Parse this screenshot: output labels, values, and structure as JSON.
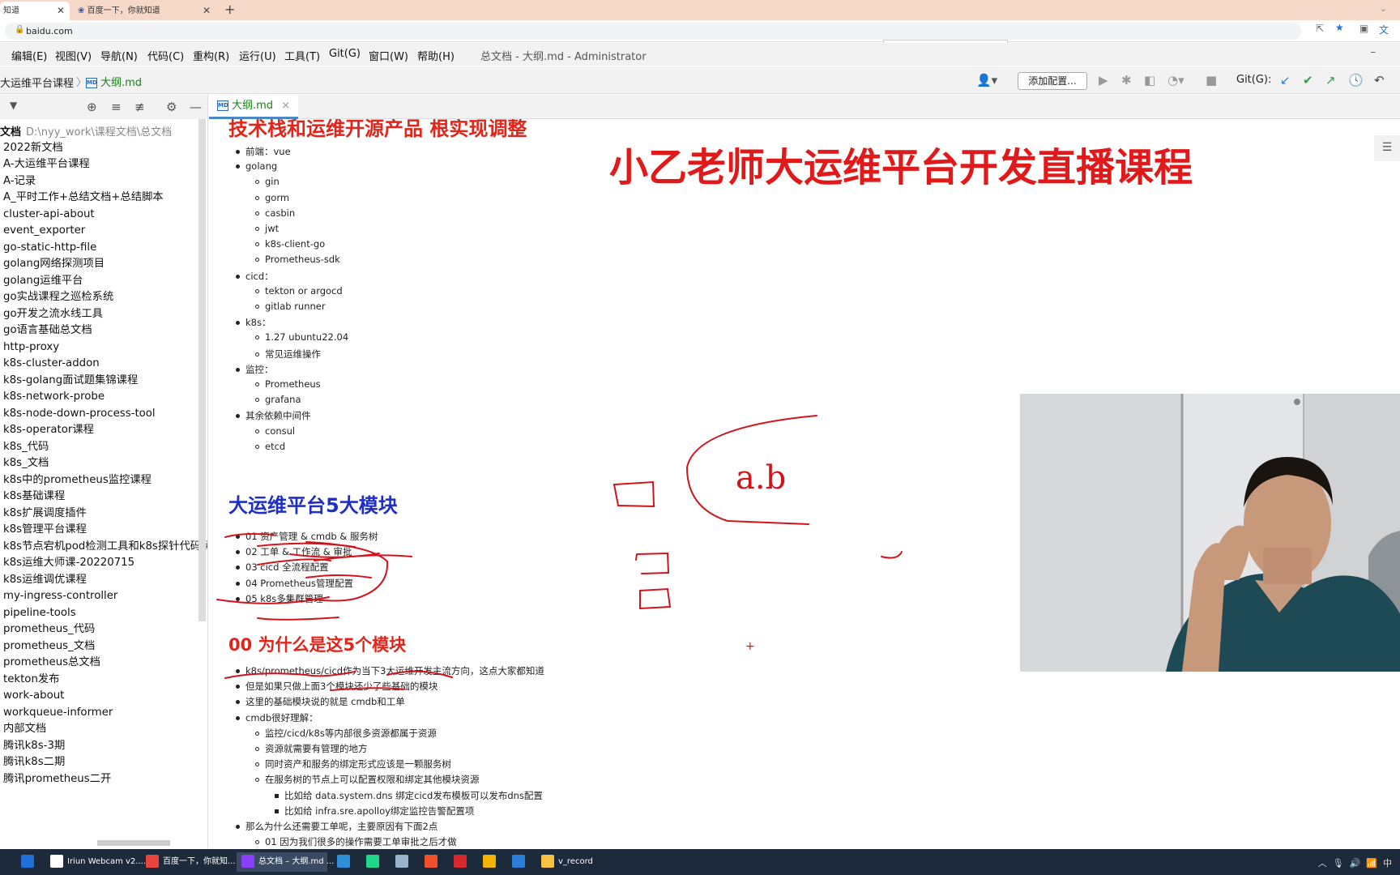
{
  "browser": {
    "tabs": [
      {
        "label": "知道",
        "close": "✕"
      },
      {
        "label": "百度一下，你就知道",
        "close": "✕"
      }
    ],
    "new_tab": "+",
    "url": "baidu.com",
    "ime": {
      "logo": "S",
      "mode": "中"
    }
  },
  "ide": {
    "menu": [
      "编辑(E)",
      "视图(V)",
      "导航(N)",
      "代码(C)",
      "重构(R)",
      "运行(U)",
      "工具(T)",
      "Git(G)",
      "窗口(W)",
      "帮助(H)"
    ],
    "window_title": "总文档 - 大纲.md - Administrator",
    "breadcrumb": [
      "大运维平台课程",
      "大纲.md"
    ],
    "md_badge": "MD",
    "add_config": "添加配置...",
    "git_label": "Git(G):",
    "editor_tab": "大纲.md",
    "editor_tab_close": "×"
  },
  "sidebar": {
    "root_label": "文档",
    "root_path": "D:\\nyy_work\\课程文档\\总文档",
    "items": [
      "2022新文档",
      "A-大运维平台课程",
      "A-记录",
      "A_平时工作+总结文档+总结脚本",
      "cluster-api-about",
      "event_exporter",
      "go-static-http-file",
      "golang网络探测项目",
      "golang运维平台",
      "go实战课程之巡检系统",
      "go开发之流水线工具",
      "go语言基础总文档",
      "http-proxy",
      "k8s-cluster-addon",
      "k8s-golang面试题集锦课程",
      "k8s-network-probe",
      "k8s-node-down-process-tool",
      "k8s-operator课程",
      "k8s_代码",
      "k8s_文档",
      "k8s中的prometheus监控课程",
      "k8s基础课程",
      "k8s扩展调度插件",
      "k8s管理平台课程",
      "k8s节点宕机pod检测工具和k8s探针代码解",
      "k8s运维大师课-20220715",
      "k8s运维调优课程",
      "my-ingress-controller",
      "pipeline-tools",
      "prometheus_代码",
      "prometheus_文档",
      "prometheus总文档",
      "tekton发布",
      "work-about",
      "workqueue-informer",
      "内部文档",
      "腾讯k8s-3期",
      "腾讯k8s二期",
      "腾讯prometheus二开"
    ]
  },
  "doc": {
    "top_heading_partial": "技术栈和运维开源产品 根实现调整",
    "big_title": "小乙老师大运维平台开发直播课程",
    "stack": [
      {
        "level": 1,
        "text": "前端：vue"
      },
      {
        "level": 1,
        "text": "golang"
      },
      {
        "level": 2,
        "text": "gin"
      },
      {
        "level": 2,
        "text": "gorm"
      },
      {
        "level": 2,
        "text": "casbin"
      },
      {
        "level": 2,
        "text": "jwt"
      },
      {
        "level": 2,
        "text": "k8s-client-go"
      },
      {
        "level": 2,
        "text": "Prometheus-sdk"
      },
      {
        "level": 1,
        "text": "cicd："
      },
      {
        "level": 2,
        "text": "tekton or argocd"
      },
      {
        "level": 2,
        "text": "gitlab runner"
      },
      {
        "level": 1,
        "text": "k8s："
      },
      {
        "level": 2,
        "text": "1.27 ubuntu22.04"
      },
      {
        "level": 2,
        "text": "常见运维操作"
      },
      {
        "level": 1,
        "text": "监控："
      },
      {
        "level": 2,
        "text": "Prometheus"
      },
      {
        "level": 2,
        "text": "grafana"
      },
      {
        "level": 1,
        "text": "其余依赖中间件"
      },
      {
        "level": 2,
        "text": "consul"
      },
      {
        "level": 2,
        "text": "etcd"
      }
    ],
    "modules_heading": "大运维平台5大模块",
    "modules": [
      "01 资产管理 & cmdb & 服务树",
      "02 工单 & 工作流 & 审批",
      "03 cicd 全流程配置",
      "04 Prometheus管理配置",
      "05 k8s多集群管理"
    ],
    "why_heading": "00 为什么是这5个模块",
    "why": [
      {
        "level": 1,
        "text": "k8s/prometheus/cicd作为当下3大运维开发主流方向，这点大家都知道"
      },
      {
        "level": 1,
        "text": "但是如果只做上面3个模块还少了些基础的模块"
      },
      {
        "level": 1,
        "text": "这里的基础模块说的就是 cmdb和工单"
      },
      {
        "level": 1,
        "text": "cmdb很好理解："
      },
      {
        "level": 2,
        "text": "监控/cicd/k8s等内部很多资源都属于资源"
      },
      {
        "level": 2,
        "text": "资源就需要有管理的地方"
      },
      {
        "level": 2,
        "text": "同时资产和服务的绑定形式应该是一颗服务树"
      },
      {
        "level": 2,
        "text": "在服务树的节点上可以配置权限和绑定其他模块资源"
      },
      {
        "level": 3,
        "text": "比如给 data.system.dns 绑定cicd发布模板可以发布dns配置"
      },
      {
        "level": 3,
        "text": "比如给 infra.sre.apolloy绑定监控告警配置项"
      },
      {
        "level": 1,
        "text": "那么为什么还需要工单呢，主要原因有下面2点"
      },
      {
        "level": 2,
        "text": "01 因为我们很多的操作需要工单审批之后才做"
      }
    ],
    "handwriting": "a.b"
  },
  "taskbar": [
    {
      "label": "",
      "icon": "ps-icon",
      "color": "#1e6fd9"
    },
    {
      "label": "Iriun Webcam v2....",
      "icon": "webcam-icon",
      "color": "#ffffff"
    },
    {
      "label": "百度一下，你就知...",
      "icon": "chrome-icon",
      "color": "#e8453c"
    },
    {
      "label": "总文档 – 大纲.md ...",
      "icon": "goland-icon",
      "color": "#8a3ffc"
    },
    {
      "label": "",
      "icon": "app-icon",
      "color": "#2f8fd8"
    },
    {
      "label": "",
      "icon": "pycharm-icon",
      "color": "#21d789"
    },
    {
      "label": "",
      "icon": "monitor-icon",
      "color": "#9bb3cc"
    },
    {
      "label": "",
      "icon": "bird-icon",
      "color": "#f0502a"
    },
    {
      "label": "",
      "icon": "red-app-icon",
      "color": "#d9272e"
    },
    {
      "label": "",
      "icon": "grid-icon",
      "color": "#f2b400"
    },
    {
      "label": "",
      "icon": "t-icon",
      "color": "#2b7fd8"
    },
    {
      "label": "v_record",
      "icon": "folder-icon",
      "color": "#f5c242"
    }
  ]
}
